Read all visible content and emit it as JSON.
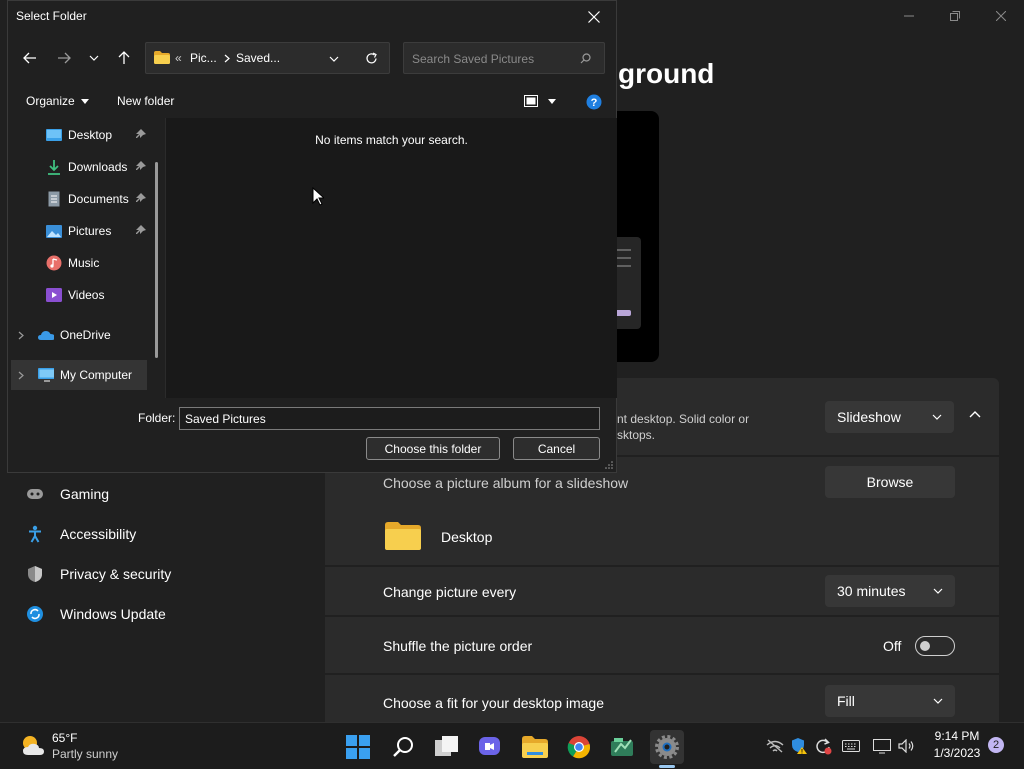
{
  "settings": {
    "page_title": "ground",
    "nav": [
      {
        "label": "Gaming",
        "icon": "gamepad-icon"
      },
      {
        "label": "Accessibility",
        "icon": "accessibility-icon"
      },
      {
        "label": "Privacy & security",
        "icon": "shield-icon"
      },
      {
        "label": "Windows Update",
        "icon": "windows-update-icon"
      }
    ],
    "personalize": {
      "description_line1": "nt desktop. Solid color or",
      "description_line2": "sktops.",
      "value": "Slideshow"
    },
    "album": {
      "label": "Choose a picture album for a slideshow",
      "browse_label": "Browse",
      "folder_name": "Desktop"
    },
    "change_picture": {
      "label": "Change picture every",
      "value": "30 minutes"
    },
    "shuffle": {
      "label": "Shuffle the picture order",
      "state_label": "Off"
    },
    "fit": {
      "label": "Choose a fit for your desktop image",
      "value": "Fill"
    }
  },
  "dialog": {
    "title": "Select Folder",
    "address": {
      "overflow": "«",
      "crumb1": "Pic...",
      "crumb2": "Saved..."
    },
    "search_placeholder": "Search Saved Pictures",
    "toolbar": {
      "organize": "Organize",
      "new_folder": "New folder"
    },
    "nav_items": [
      {
        "label": "Desktop",
        "icon": "desktop-folder-icon",
        "pinned": true
      },
      {
        "label": "Downloads",
        "icon": "downloads-icon",
        "pinned": true
      },
      {
        "label": "Documents",
        "icon": "documents-icon",
        "pinned": true
      },
      {
        "label": "Pictures",
        "icon": "pictures-icon",
        "pinned": true
      },
      {
        "label": "Music",
        "icon": "music-icon",
        "pinned": false
      },
      {
        "label": "Videos",
        "icon": "videos-icon",
        "pinned": false
      },
      {
        "label": "OneDrive",
        "icon": "onedrive-icon",
        "pinned": false
      },
      {
        "label": "My Computer",
        "icon": "computer-icon",
        "pinned": false
      }
    ],
    "empty_message": "No items match your search.",
    "folder_label": "Folder:",
    "folder_value": "Saved Pictures",
    "choose_button": "Choose this folder",
    "cancel_button": "Cancel"
  },
  "taskbar": {
    "weather": {
      "temp": "65°F",
      "condition": "Partly sunny"
    },
    "apps": [
      "start-icon",
      "search-icon",
      "task-view-icon",
      "teams-chat-icon",
      "file-explorer-icon",
      "chrome-icon",
      "app-icon",
      "settings-icon"
    ],
    "clock": {
      "time": "9:14 PM",
      "date": "1/3/2023"
    },
    "notification_count": "2"
  },
  "colors": {
    "accent": "#0078d4",
    "folder_yellow": "#f3c537",
    "background": "#202020",
    "card": "#2b2b2b"
  }
}
